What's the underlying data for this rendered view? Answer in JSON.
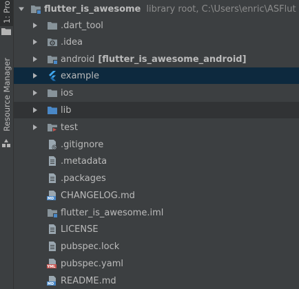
{
  "sidebar": {
    "project_tab": "1: Pro",
    "resource_tab": "Resource Manager"
  },
  "root": {
    "name": "flutter_is_awesome",
    "hint": "library root,  C:\\Users\\enric\\ASFlut"
  },
  "items": [
    {
      "label": "dart_tool",
      "prefix": ".",
      "icon": "folder-icon",
      "expandable": true
    },
    {
      "label": ".idea",
      "icon": "settings-folder-icon",
      "expandable": true
    },
    {
      "label": "android",
      "module": "[flutter_is_awesome_android]",
      "icon": "module-folder-icon",
      "expandable": true
    },
    {
      "label": "example",
      "icon": "flutter-icon",
      "expandable": true
    },
    {
      "label": "ios",
      "icon": "folder-icon",
      "expandable": true
    },
    {
      "label": "lib",
      "icon": "source-folder-icon",
      "expandable": true
    },
    {
      "label": "test",
      "icon": "test-folder-icon",
      "expandable": true
    },
    {
      "label": ".gitignore",
      "icon": "gitignore-file-icon",
      "expandable": false
    },
    {
      "label": ".metadata",
      "icon": "text-file-icon",
      "expandable": false
    },
    {
      "label": ".packages",
      "icon": "text-file-icon",
      "expandable": false
    },
    {
      "label": "CHANGELOG.md",
      "icon": "markdown-file-icon",
      "expandable": false
    },
    {
      "label": "flutter_is_awesome.iml",
      "icon": "iml-file-icon",
      "expandable": false
    },
    {
      "label": "LICENSE",
      "icon": "text-file-icon",
      "expandable": false
    },
    {
      "label": "pubspec.lock",
      "icon": "text-file-icon",
      "expandable": false
    },
    {
      "label": "pubspec.yaml",
      "icon": "yaml-file-icon",
      "expandable": false
    },
    {
      "label": "README.md",
      "icon": "markdown-file-icon",
      "expandable": false
    }
  ],
  "colors": {
    "background": "#3c3f41",
    "selected_row": "#0d293e",
    "folder": "#87939a",
    "source_folder": "#4a88c7",
    "flutter_blue": "#40a8f0",
    "test_red": "#c75450"
  }
}
